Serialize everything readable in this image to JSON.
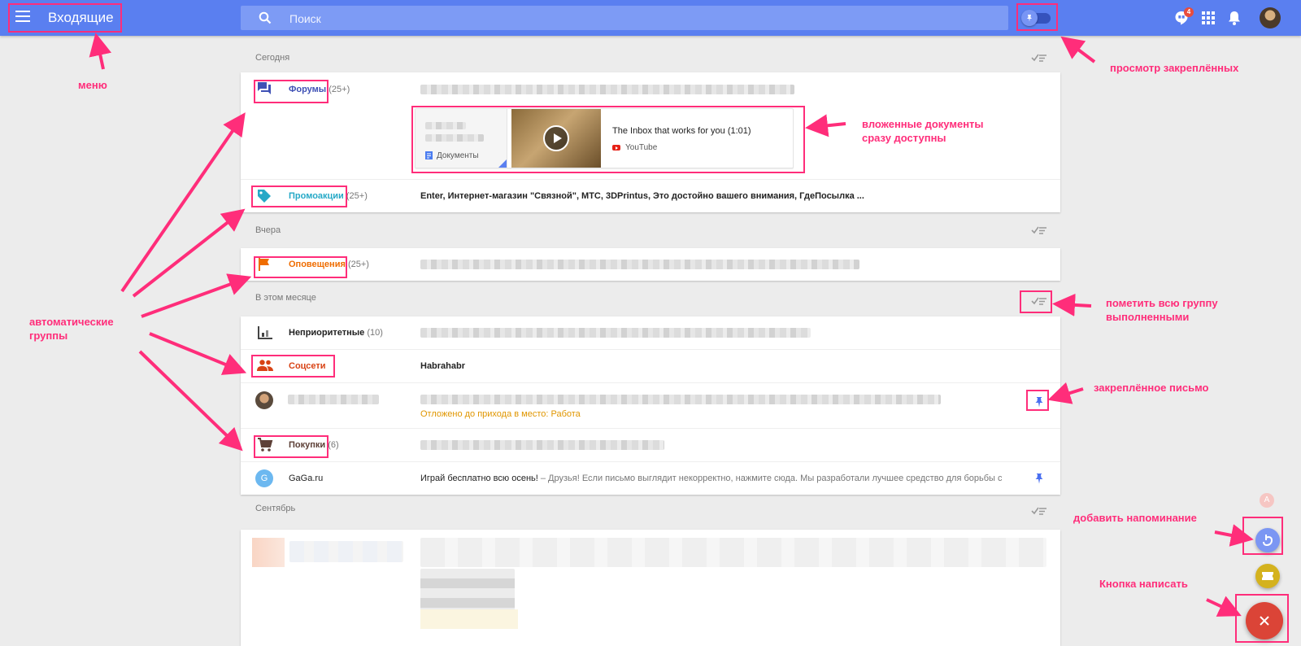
{
  "header": {
    "title": "Входящие",
    "search_placeholder": "Поиск",
    "notification_count": "4"
  },
  "sections": [
    {
      "label": "Сегодня",
      "rows": [
        {
          "name": "Форумы",
          "count": "(25+)",
          "color": "#3f51b5",
          "icon": "forum-icon",
          "attachments": {
            "doc_label": "Документы",
            "video_title": "The Inbox that works for you (1:01)",
            "video_source": "YouTube"
          }
        },
        {
          "name": "Промоакции",
          "count": "(25+)",
          "color": "#26a9c7",
          "icon": "tag-icon",
          "snippet": "Enter, Интернет-магазин \"Связной\", МТС, 3DPrintus, Это достойно вашего внимания, ГдеПосылка ..."
        }
      ]
    },
    {
      "label": "Вчера",
      "rows": [
        {
          "name": "Оповещения",
          "count": "(25+)",
          "color": "#ef6c00",
          "icon": "flag-icon"
        }
      ]
    },
    {
      "label": "В этом месяце",
      "rows": [
        {
          "name": "Неприоритетные",
          "count": "(10)",
          "color": "#212121",
          "icon": "low-priority-icon"
        },
        {
          "name": "Соцсети",
          "color": "#d84315",
          "icon": "people-icon",
          "snippet": "Habrahabr"
        },
        {
          "snooze_text": "Отложено до прихода в место: Работа"
        },
        {
          "name": "Покупки",
          "count": "(6)",
          "color": "#5d4037",
          "icon": "cart-icon"
        },
        {
          "name": "GaGa.ru",
          "avatar_letter": "G",
          "snippet_bold": "Играй бесплатно всю осень!",
          "snippet_rest": " – Друзья! Если письмо выглядит некорректно, нажмите сюда. Мы разработали лучшее средство для борьбы с"
        }
      ]
    },
    {
      "label": "Сентябрь"
    }
  ],
  "fab": {
    "reminder_letter": "A"
  },
  "annotations": {
    "menu": "меню",
    "pinned_view": "просмотр закреплённых",
    "attachments_1": "вложенные документы",
    "attachments_2": "сразу доступны",
    "mark_done_1": "пометить всю группу",
    "mark_done_2": "выполненными",
    "auto_groups_1": "автоматические",
    "auto_groups_2": "группы",
    "pinned_email": "закреплённое письмо",
    "add_reminder": "добавить напоминание",
    "compose": "Кнопка написать",
    "color": "#ff2d7a"
  }
}
